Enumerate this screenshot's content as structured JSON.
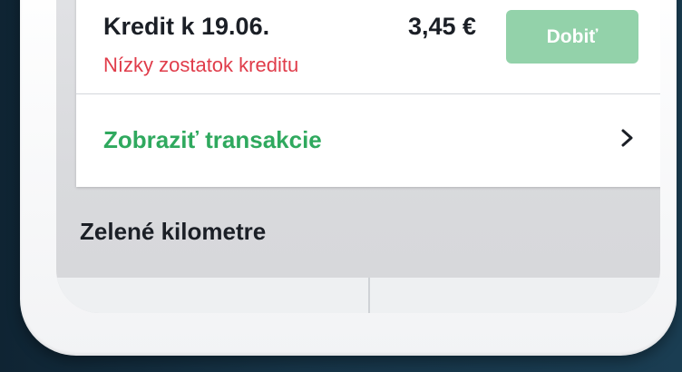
{
  "credit": {
    "title": "Kredit k 19.06.",
    "amount": "3,45 €",
    "warning": "Nízky zostatok kreditu",
    "warning_color": "#e03c4a",
    "topup_label": "Dobiť",
    "topup_color": "#93d2aa",
    "topup_enabled": false
  },
  "transactions": {
    "label": "Zobraziť transakcie",
    "label_color": "#2fa95e",
    "icon": "chevron-right-icon"
  },
  "green_km": {
    "title": "Zelené kilometre"
  }
}
